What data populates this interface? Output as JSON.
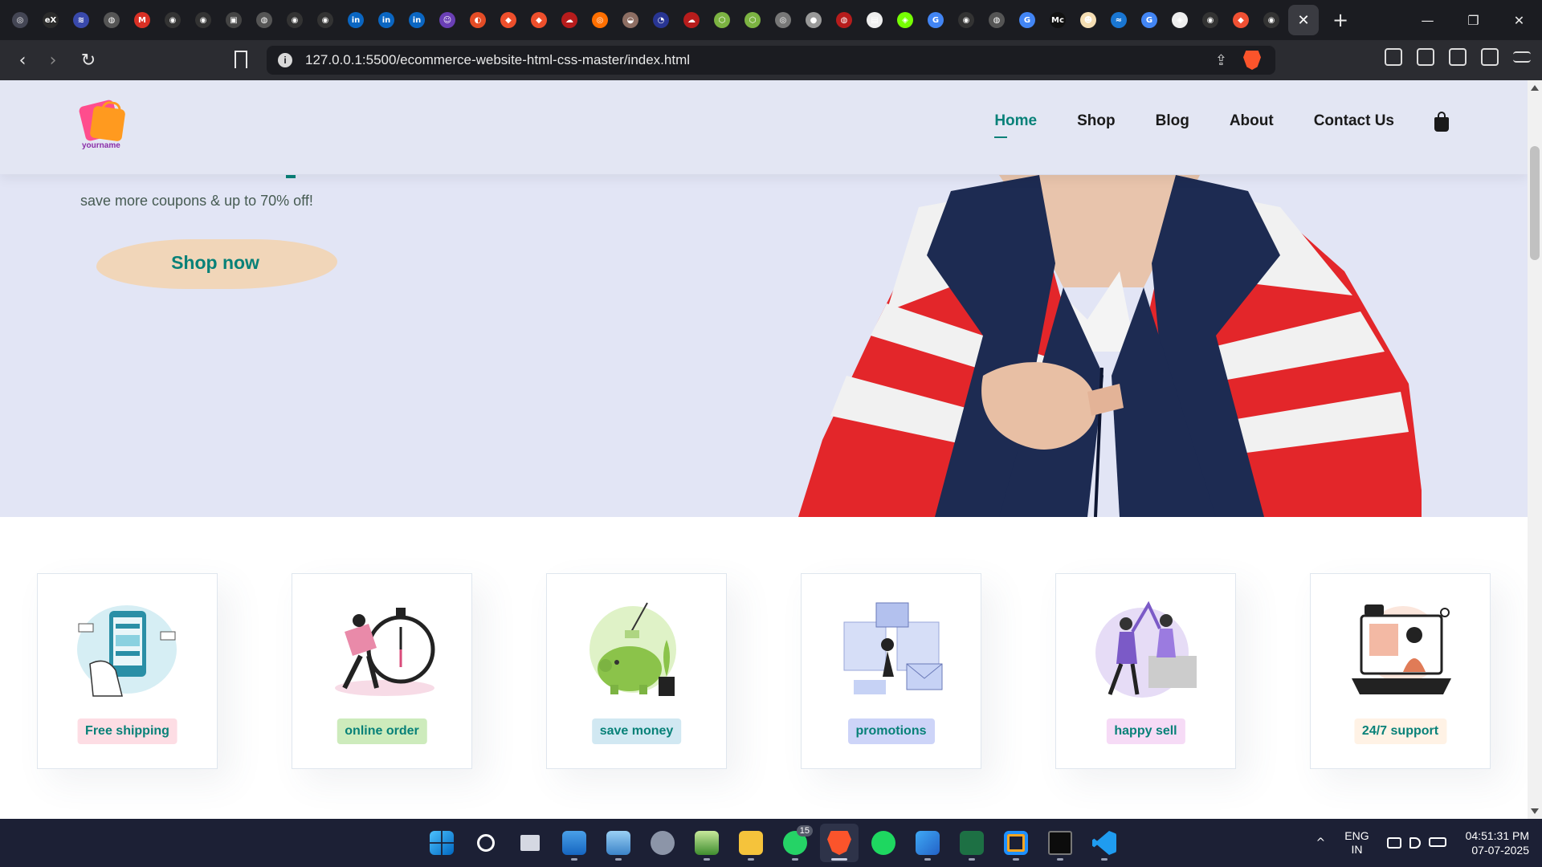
{
  "browser": {
    "url": "127.0.0.1:5500/ecommerce-website-html-css-master/index.html",
    "tab_favicons": [
      {
        "icon": "chatgpt-icon",
        "color": "#444654",
        "glyph": "◎"
      },
      {
        "icon": "edx-icon",
        "color": "#2b2b2b",
        "glyph": "eX"
      },
      {
        "icon": "tab-icon-3",
        "color": "#3949ab",
        "glyph": "≋"
      },
      {
        "icon": "globe-icon",
        "color": "#555",
        "glyph": "◍"
      },
      {
        "icon": "gmail-icon",
        "color": "#d93025",
        "glyph": "M"
      },
      {
        "icon": "github-icon",
        "color": "#333",
        "glyph": "◉"
      },
      {
        "icon": "github-icon",
        "color": "#333",
        "glyph": "◉"
      },
      {
        "icon": "tab-icon-8",
        "color": "#444",
        "glyph": "▣"
      },
      {
        "icon": "globe-icon",
        "color": "#555",
        "glyph": "◍"
      },
      {
        "icon": "github-icon",
        "color": "#333",
        "glyph": "◉"
      },
      {
        "icon": "github-icon",
        "color": "#333",
        "glyph": "◉"
      },
      {
        "icon": "linkedin-icon",
        "color": "#0a66c2",
        "glyph": "in"
      },
      {
        "icon": "linkedin-icon",
        "color": "#0a66c2",
        "glyph": "in"
      },
      {
        "icon": "linkedin-icon",
        "color": "#0a66c2",
        "glyph": "in"
      },
      {
        "icon": "tab-icon-15",
        "color": "#6a3fb5",
        "glyph": "☺"
      },
      {
        "icon": "tab-icon-16",
        "color": "#e34c26",
        "glyph": "◐"
      },
      {
        "icon": "tab-icon-17",
        "color": "#ee4f2c",
        "glyph": "◆"
      },
      {
        "icon": "tab-icon-18",
        "color": "#ee4f2c",
        "glyph": "◆"
      },
      {
        "icon": "cloud-icon",
        "color": "#b71c1c",
        "glyph": "☁"
      },
      {
        "icon": "tab-icon-20",
        "color": "#ff6f00",
        "glyph": "◎"
      },
      {
        "icon": "tab-icon-21",
        "color": "#8d6e63",
        "glyph": "◒"
      },
      {
        "icon": "tab-icon-22",
        "color": "#283593",
        "glyph": "◔"
      },
      {
        "icon": "cloud-icon",
        "color": "#b71c1c",
        "glyph": "☁"
      },
      {
        "icon": "tab-icon-24",
        "color": "#7cb342",
        "glyph": "⬡"
      },
      {
        "icon": "tab-icon-25",
        "color": "#7cb342",
        "glyph": "⬡"
      },
      {
        "icon": "tab-icon-26",
        "color": "#777",
        "glyph": "◎"
      },
      {
        "icon": "tab-icon-27",
        "color": "#999",
        "glyph": "●"
      },
      {
        "icon": "tab-icon-28",
        "color": "#b71c1c",
        "glyph": "◍"
      },
      {
        "icon": "tab-icon-29",
        "color": "#eee",
        "glyph": "▤"
      },
      {
        "icon": "tab-icon-30",
        "color": "#76ff03",
        "glyph": "◈"
      },
      {
        "icon": "google-icon",
        "color": "#4285f4",
        "glyph": "G"
      },
      {
        "icon": "github-icon",
        "color": "#333",
        "glyph": "◉"
      },
      {
        "icon": "globe-icon",
        "color": "#555",
        "glyph": "◍"
      },
      {
        "icon": "google-icon",
        "color": "#4285f4",
        "glyph": "G"
      },
      {
        "icon": "medium-icon",
        "color": "#111",
        "glyph": "Mc"
      },
      {
        "icon": "tab-icon-36",
        "color": "#f5deb3",
        "glyph": "☻"
      },
      {
        "icon": "tab-icon-37",
        "color": "#1976d2",
        "glyph": "≈"
      },
      {
        "icon": "google-icon",
        "color": "#4285f4",
        "glyph": "G"
      },
      {
        "icon": "tab-icon-39",
        "color": "#eee",
        "glyph": "◈"
      },
      {
        "icon": "github-icon",
        "color": "#333",
        "glyph": "◉"
      },
      {
        "icon": "git-icon",
        "color": "#f05033",
        "glyph": "◆"
      },
      {
        "icon": "github-icon",
        "color": "#333",
        "glyph": "◉"
      }
    ]
  },
  "site": {
    "logo_text": "yourname",
    "nav": [
      {
        "label": "Home",
        "active": true
      },
      {
        "label": "Shop",
        "active": false
      },
      {
        "label": "Blog",
        "active": false
      },
      {
        "label": "About",
        "active": false
      },
      {
        "label": "Contact Us",
        "active": false
      }
    ],
    "hero": {
      "subtitle": "save more coupons & up to 70% off!",
      "button_label": "Shop now"
    },
    "features": [
      {
        "label": "Free shipping",
        "tag_color": "#fddde4",
        "icon": "shipping-payment-icon"
      },
      {
        "label": "online order",
        "tag_color": "#cdebbc",
        "icon": "online-order-icon"
      },
      {
        "label": "save money",
        "tag_color": "#d1e8f2",
        "icon": "piggy-bank-icon"
      },
      {
        "label": "promotions",
        "tag_color": "#cdd4f8",
        "icon": "promotions-icon"
      },
      {
        "label": "happy sell",
        "tag_color": "#f6dbf6",
        "icon": "high-five-icon"
      },
      {
        "label": "24/7 support",
        "tag_color": "#fff2e5",
        "icon": "support-laptop-icon"
      }
    ],
    "accent_color": "#088178"
  },
  "taskbar": {
    "notification_badge": "15",
    "lang_line1": "ENG",
    "lang_line2": "IN",
    "time": "04:51:31 PM",
    "date": "07-07-2025"
  }
}
